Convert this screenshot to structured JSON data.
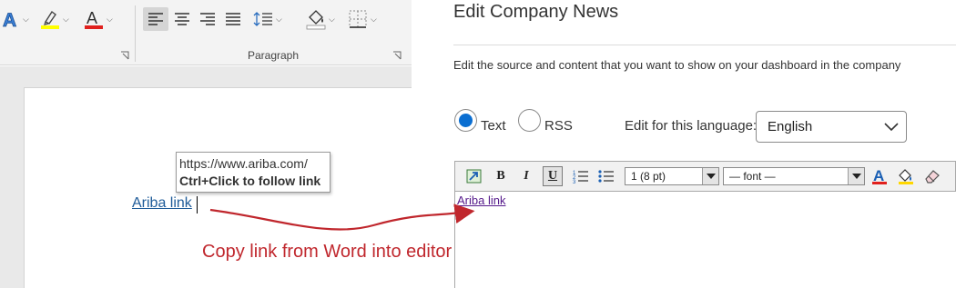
{
  "word": {
    "ribbon": {
      "paragraph_group_label": "Paragraph"
    },
    "tooltip": {
      "url": "https://www.ariba.com/",
      "hint_key": "Ctrl",
      "hint_rest": "+Click to follow link"
    },
    "link_text": "Ariba link"
  },
  "editor": {
    "title": "Edit Company News",
    "description": "Edit the source and content that you want to show on your dashboard in the company",
    "source_options": [
      {
        "label": "Text",
        "selected": true
      },
      {
        "label": "RSS",
        "selected": false
      }
    ],
    "language_label": "Edit for this language:",
    "language_value": "English",
    "toolbar": {
      "bold": "B",
      "italic": "I",
      "underline": "U",
      "size_value": "1 (8 pt)",
      "font_value": "— font —"
    },
    "content_link": "Ariba link"
  },
  "annotation": {
    "text": "Copy link from Word into editor",
    "color": "#c0272d"
  },
  "colors": {
    "accent_blue": "#0a6ed1",
    "word_link": "#1f5c99",
    "visited_link": "#551a8b",
    "highlight_yellow": "#ffff00",
    "font_red": "#e0201d"
  }
}
